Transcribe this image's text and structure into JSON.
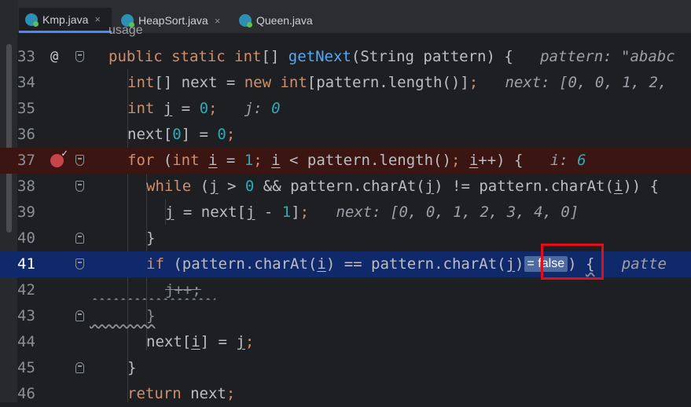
{
  "tabs": [
    {
      "label": "Kmp.java",
      "active": true
    },
    {
      "label": "HeapSort.java",
      "active": false
    },
    {
      "label": "Queen.java",
      "active": false
    }
  ],
  "tab_close_glyph": "×",
  "top_fragment": "usage",
  "lines": {
    "33": "33",
    "34": "34",
    "35": "35",
    "36": "36",
    "37": "37",
    "38": "38",
    "39": "39",
    "40": "40",
    "41": "41",
    "42": "42",
    "43": "43",
    "44": "44",
    "45": "45",
    "46": "46"
  },
  "gutter_marks": {
    "override_icon": "@"
  },
  "hints": {
    "pattern": "pattern: \"ababc",
    "next_partial": "next: [0, 0, 1, 2,",
    "j_label": "j:",
    "j_value": "0",
    "i_label": "i:",
    "i_value": "6",
    "next_full": "next: [0, 0, 1, 2, 3, 4, 0]",
    "eval": "= false",
    "tail": "patte"
  },
  "colors": {
    "breakpoint_line": "#3b1512",
    "execution_line": "#10296a",
    "highlight_box": "#e0101a"
  }
}
